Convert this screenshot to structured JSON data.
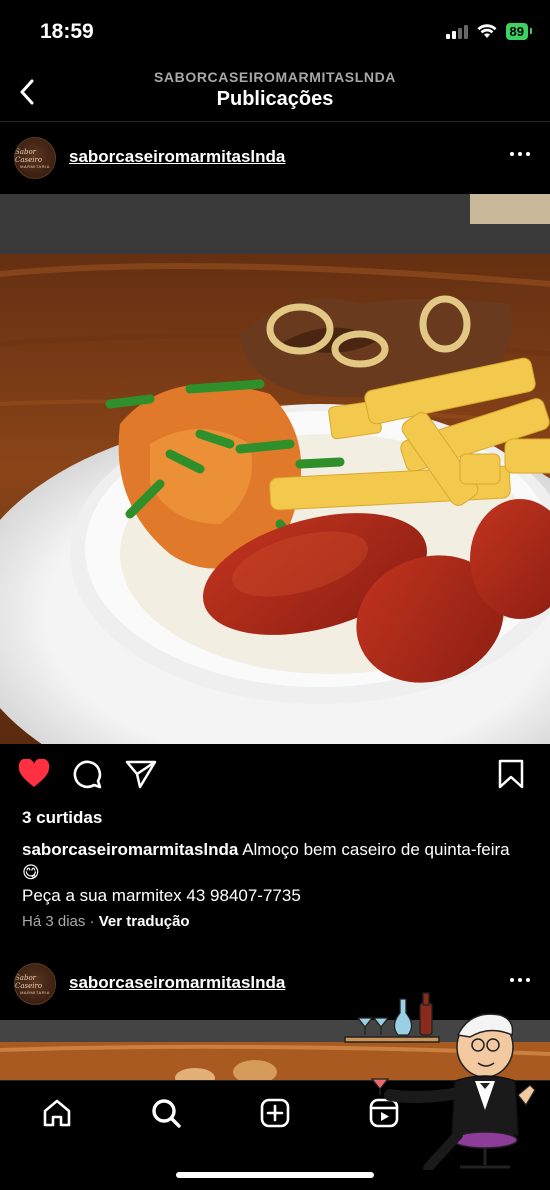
{
  "status": {
    "time": "18:59",
    "battery": "89"
  },
  "header": {
    "subtitle": "SABORCASEIROMARMITASLNDA",
    "title": "Publicações"
  },
  "post": {
    "username": "saborcaseiromarmitaslnda",
    "avatar_text_top": "Sabor Caseiro",
    "avatar_text_bottom": "MARMITARIA",
    "liked": true,
    "likes": "3 curtidas",
    "caption_user": "saborcaseiromarmitaslnda",
    "caption_text": "Almoço bem caseiro de quinta-feira 😋",
    "caption_line2": "Peça a sua marmitex 43 98407-7735",
    "time_ago": "Há 3 dias",
    "separator": "·",
    "translate": "Ver tradução"
  },
  "post2": {
    "username": "saborcaseiromarmitaslnda"
  },
  "icons": {
    "back": "chevron-left-icon",
    "more": "more-horizontal-icon",
    "like": "heart-icon",
    "comment": "comment-icon",
    "share": "send-icon",
    "save": "bookmark-icon",
    "home": "home-icon",
    "search": "search-icon",
    "create": "plus-square-icon",
    "reels": "reels-icon"
  },
  "colors": {
    "background": "#000000",
    "like": "#ff3040",
    "battery": "#3dd161"
  }
}
